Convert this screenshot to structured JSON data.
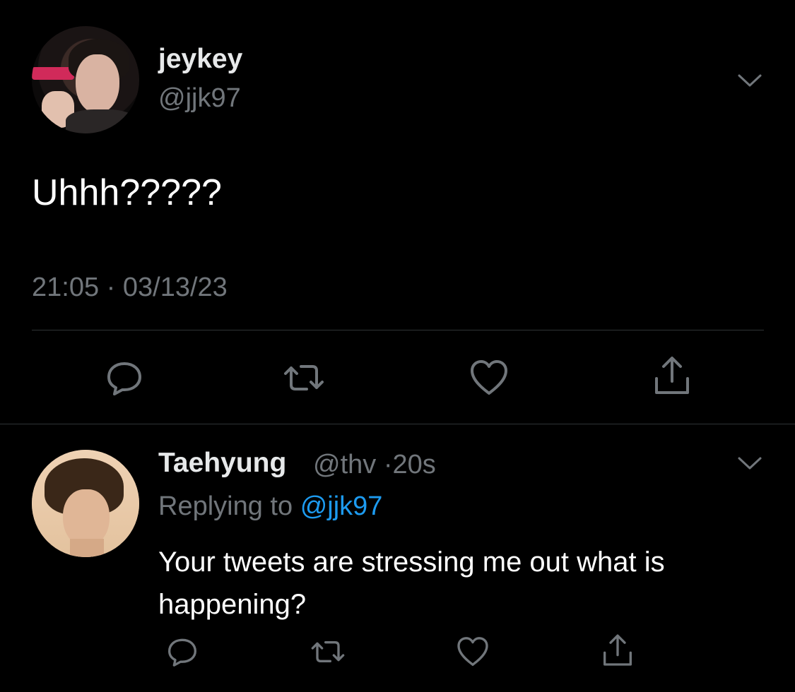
{
  "tweet": {
    "author": {
      "display_name": "jeykey",
      "handle": "@jjk97"
    },
    "text": "Uhhh?????",
    "timestamp": "21:05 · 03/13/23",
    "actions": [
      "reply-icon",
      "retweet-icon",
      "like-icon",
      "share-icon"
    ]
  },
  "reply": {
    "author": {
      "display_name": "Taehyung",
      "handle": "@thv",
      "separator": "·",
      "time_ago": "20s"
    },
    "replying_to_label": "Replying to",
    "replying_to_handle": "@jjk97",
    "text": "Your tweets are stressing me out what is happening?",
    "actions": [
      "reply-icon",
      "retweet-icon",
      "like-icon",
      "share-icon"
    ]
  },
  "colors": {
    "background": "#000000",
    "text_primary": "#e7e9ea",
    "text_secondary": "#71767b",
    "link": "#1d9bf0",
    "divider": "#2f3336"
  }
}
